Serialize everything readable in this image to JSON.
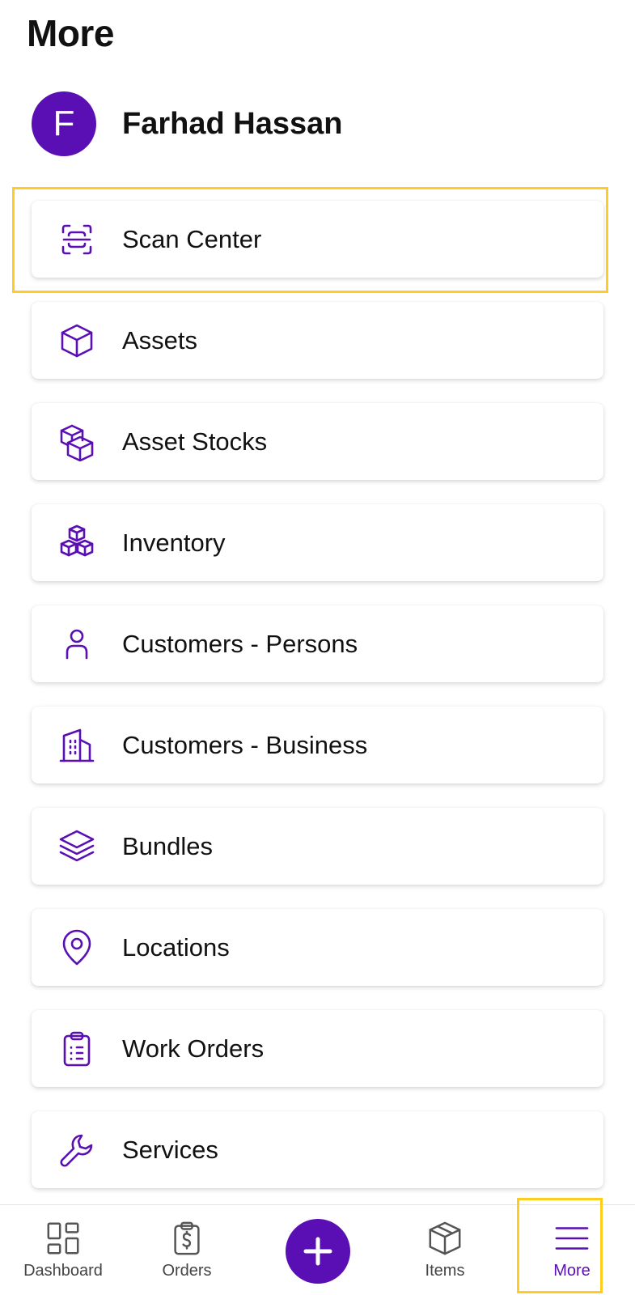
{
  "page": {
    "title": "More"
  },
  "profile": {
    "initial": "F",
    "name": "Farhad Hassan"
  },
  "menu": {
    "items": [
      {
        "label": "Scan Center",
        "icon": "scan-icon"
      },
      {
        "label": "Assets",
        "icon": "box-icon"
      },
      {
        "label": "Asset Stocks",
        "icon": "stacked-boxes-icon"
      },
      {
        "label": "Inventory",
        "icon": "boxes-pyramid-icon"
      },
      {
        "label": "Customers - Persons",
        "icon": "person-icon"
      },
      {
        "label": "Customers - Business",
        "icon": "building-icon"
      },
      {
        "label": "Bundles",
        "icon": "layers-icon"
      },
      {
        "label": "Locations",
        "icon": "location-pin-icon"
      },
      {
        "label": "Work Orders",
        "icon": "clipboard-icon"
      },
      {
        "label": "Services",
        "icon": "wrench-icon"
      }
    ]
  },
  "bottom_nav": {
    "items": [
      {
        "label": "Dashboard",
        "icon": "dashboard-icon"
      },
      {
        "label": "Orders",
        "icon": "orders-icon"
      },
      {
        "label": "Add",
        "icon": "plus-icon"
      },
      {
        "label": "Items",
        "icon": "box-icon"
      },
      {
        "label": "More",
        "icon": "hamburger-icon",
        "active": true
      }
    ]
  },
  "colors": {
    "accent": "#5a0fb4",
    "highlight": "#ffcc1f",
    "text": "#111111",
    "nav_text": "#444444"
  }
}
